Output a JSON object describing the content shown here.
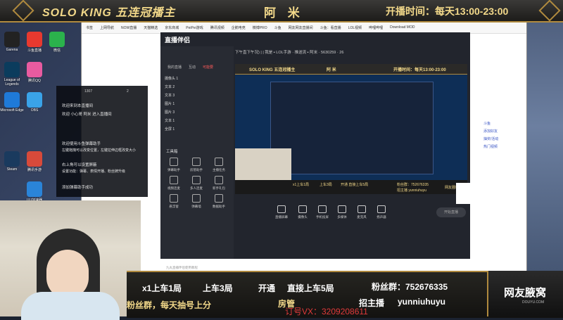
{
  "top_banner": {
    "title_left": "SOLO KING 五连冠播主",
    "title_mid": "阿 米",
    "title_right": "开播时间：每天13:00-23:00"
  },
  "bookmarks": [
    "书签",
    "上网导航",
    "NOW直播",
    "天猫精选",
    "京东商城",
    "PeiPei游戏",
    "腾讯视频",
    "企鹅电竞",
    "微博PRO",
    "斗鱼",
    "网友网友直播间",
    "斗鱼：看直播",
    "LOL视频",
    "哔哩哔哩",
    "Download MOD"
  ],
  "browser_side": {
    "items": [
      "斗鱼",
      "添加好友",
      "抽奖/活动",
      "热门视频"
    ]
  },
  "desktop_icons": [
    {
      "label": "Garena"
    },
    {
      "label": "斗鱼直播"
    },
    {
      "label": "微信"
    },
    {
      "label": "League of Legends"
    },
    {
      "label": "腾讯QQ"
    },
    {
      "label": "Microsoft Edge"
    },
    {
      "label": "OBS"
    },
    {
      "label": "Steam"
    },
    {
      "label": "腾讯手游"
    },
    {
      "label": "UU加速器"
    }
  ],
  "chat": {
    "header_count": "1307",
    "header_count2": "2",
    "lines": [
      "欢迎来到本直播间",
      "欢迎 小心哥 阿米 进入直播间",
      "欢迎使用斗鱼弹幕助手",
      "左键拖拽可以改变位置，左键拉伸边框改变大小",
      "右上角可以设置屏蔽",
      "设置功能：弹幕、表情开播、粉丝牌升级",
      "添加弹幕助手成功"
    ]
  },
  "app": {
    "name": "直播伴侣",
    "tabs": [
      "我的直播",
      "互动",
      "可能要"
    ],
    "top_info": "下午直下午况) | | 我是 ▪ LOL手游 · 推送流 ▪ 阿米 · 5630259 · 26",
    "scenes": [
      "摄像头 1",
      "文本 2",
      "文本 3",
      "图片 1",
      "图片 3",
      "文本 1",
      "全屏 1"
    ],
    "tools_title": "工具箱",
    "tools": [
      "弹幕助手",
      "房管助手",
      "主播任务",
      "视频连麦",
      "多人连麦",
      "新手礼包",
      "悬浮窗",
      "弹幕墙",
      "数据助手"
    ],
    "controls": [
      "直播屏幕",
      "摄像头",
      "手机投屏",
      "多媒体",
      "麦克风",
      "扬声器"
    ],
    "start_label": "开始直播",
    "status": "九丸直播伴侣使用教程"
  },
  "preview": {
    "banner_left": "SOLO KING 五连冠播主",
    "banner_mid": "阿 米",
    "banner_right": "开播时间：每天13:00-23:00",
    "bottom_a": "x1上车1局",
    "bottom_b": "上车3局",
    "bottom_c": "开通 直接上车5局",
    "bottom_d": "粉丝群：752676335",
    "bottom_e": "招主播 yunniuhuyu",
    "bottom_f": "网友圈粉"
  },
  "bottom_banner": {
    "a": "x1上车1局",
    "b": "上车3局",
    "c": "开通",
    "d": "直接上车5局",
    "e": "粉丝群：752676335",
    "f": "粉丝群，每天抽号上分",
    "g": "房管",
    "h": "招主播",
    "i": "yunniuhuyu"
  },
  "watermark": "订号VX：3209208611",
  "logo": {
    "main": "网友腋窝",
    "sub": "DOUYU.COM"
  },
  "colors": {
    "gold": "#f3d98a",
    "accent": "#ff5a5a"
  }
}
